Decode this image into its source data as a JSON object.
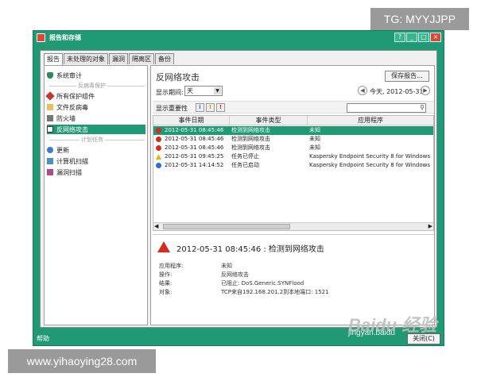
{
  "watermarks": {
    "top": "TG: MYYJJPP",
    "bottom": "www.yihaoying28.com",
    "baidu": "Baidu 经验",
    "jingyan": "jingyan.baidu"
  },
  "window": {
    "title": "报告和存储",
    "controls": [
      "?",
      "_",
      "□",
      "×"
    ]
  },
  "tabs": [
    "报告",
    "未处理的对象",
    "漏洞",
    "隔离区",
    "备份"
  ],
  "sidebar": {
    "items": [
      {
        "label": "系统审计",
        "icon": "shield-icon"
      },
      {
        "label": "所有保护组件",
        "icon": "components-icon"
      },
      {
        "label": "文件反病毒",
        "icon": "folder-icon"
      },
      {
        "label": "防火墙",
        "icon": "firewall-icon"
      },
      {
        "label": "反网络攻击",
        "icon": "network-attack-icon",
        "selected": true
      },
      {
        "label": "更新",
        "icon": "update-icon"
      },
      {
        "label": "计算机扫描",
        "icon": "scan-icon"
      },
      {
        "label": "漏洞扫描",
        "icon": "vulnerability-icon"
      }
    ],
    "separators": [
      "反病毒保护",
      "计划任务"
    ]
  },
  "content": {
    "heading": "反网络攻击",
    "save_button": "保存报告...",
    "period_label": "显示期间:",
    "period_value": "天",
    "prev": "◀",
    "next": "▶",
    "today": "今天, 2012-05-31",
    "filter_label": "显示重要性",
    "filter_icons": [
      "i",
      "!",
      "!"
    ],
    "columns": [
      "事件日期",
      "事件类型",
      "应用程序"
    ],
    "rows": [
      {
        "date": "2012-05-31 08:45:46",
        "type": "检测到网络攻击",
        "app": "未知",
        "severity": "critical",
        "selected": true
      },
      {
        "date": "2012-05-31 08:45:46",
        "type": "检测到网络攻击",
        "app": "未知",
        "severity": "critical"
      },
      {
        "date": "2012-05-31 08:45:46",
        "type": "检测到网络攻击",
        "app": "未知",
        "severity": "critical"
      },
      {
        "date": "2012-05-31 09:45:25",
        "type": "任务已停止",
        "app": "Kaspersky Endpoint Security 8 for Windows",
        "severity": "warning"
      },
      {
        "date": "2012-05-31 14:14:52",
        "type": "任务已启动",
        "app": "Kaspersky Endpoint Security 8 for Windows",
        "severity": "info"
      }
    ],
    "detail": {
      "title": "2012-05-31 08:45:46 : 检测到网络攻击",
      "fields": [
        {
          "k": "应用程序:",
          "v": "未知"
        },
        {
          "k": "操作:",
          "v": "反网络攻击"
        },
        {
          "k": "结果:",
          "v": "已阻止: DoS.Generic.SYNFlood"
        },
        {
          "k": "对象:",
          "v": "TCP来自192.168.201.2到本地端口: 1521"
        }
      ]
    }
  },
  "status": {
    "text": "帮助",
    "close_button": "关闭(C)"
  },
  "colors": {
    "window_green": "#1f9a74",
    "critical": "#d62b1f",
    "warning": "#f0b400",
    "info": "#2a6fc9"
  }
}
